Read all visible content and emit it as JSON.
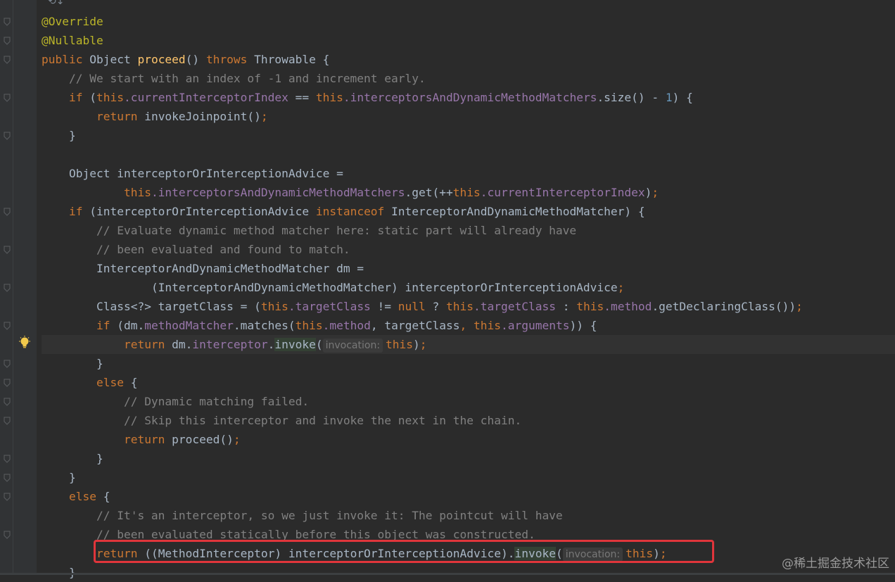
{
  "editor": {
    "top_icons": "⟲↓",
    "watermark": "@稀土掘金技术社区",
    "lines": {
      "l1": "@Override",
      "l2": "@Nullable",
      "l3_public": "public",
      "l3_object": " Object ",
      "l3_name": "proceed",
      "l3_paren": "() ",
      "l3_throws": "throws",
      "l3_rest": " Throwable {",
      "l4": "    // We start with an index of -1 and increment early.",
      "l5_if": "if",
      "l5_a": " (",
      "l5_this1": "this",
      "l5_f1": ".currentInterceptorIndex",
      "l5_b": " == ",
      "l5_this2": "this",
      "l5_f2": ".interceptorsAndDynamicMethodMatchers",
      "l5_c": ".size() - ",
      "l5_num": "1",
      "l5_d": ") {",
      "l6_return": "return",
      "l6_rest": " invokeJoinpoint()",
      "l6_semi": ";",
      "l7": "}",
      "l9": "Object interceptorOrInterceptionAdvice =",
      "l10_this1": "this",
      "l10_f1": ".interceptorsAndDynamicMethodMatchers",
      "l10_a": ".get(++",
      "l10_this2": "this",
      "l10_f2": ".currentInterceptorIndex",
      "l10_b": ")",
      "l10_semi": ";",
      "l11_if": "if",
      "l11_a": " (interceptorOrInterceptionAdvice ",
      "l11_instanceof": "instanceof",
      "l11_b": " InterceptorAndDynamicMethodMatcher) {",
      "l12": "// Evaluate dynamic method matcher here: static part will already have",
      "l13": "// been evaluated and found to match.",
      "l14": "InterceptorAndDynamicMethodMatcher dm =",
      "l15_a": "(InterceptorAndDynamicMethodMatcher) interceptorOrInterceptionAdvice",
      "l15_semi": ";",
      "l16_a": "Class<?> targetClass = (",
      "l16_this1": "this",
      "l16_f1": ".targetClass",
      "l16_b": " != ",
      "l16_null": "null",
      "l16_c": " ? ",
      "l16_this2": "this",
      "l16_f2": ".targetClass",
      "l16_d": " : ",
      "l16_this3": "this",
      "l16_f3": ".method",
      "l16_e": ".getDeclaringClass())",
      "l16_semi": ";",
      "l17_if": "if",
      "l17_a": " (dm.",
      "l17_f1": "methodMatcher",
      "l17_b": ".matches(",
      "l17_this1": "this",
      "l17_f2": ".method",
      "l17_c": ", targetClass",
      "l17_comma": ", ",
      "l17_this2": "this",
      "l17_f3": ".arguments",
      "l17_d": ")) {",
      "l18_return": "return",
      "l18_a": " dm.",
      "l18_f1": "interceptor",
      "l18_b": ".",
      "l18_invoke": "invoke",
      "l18_c": "(",
      "l18_hint": "invocation:",
      "l18_this": "this",
      "l18_d": ")",
      "l18_semi": ";",
      "l19": "}",
      "l20_else": "else",
      "l20_a": " {",
      "l21": "// Dynamic matching failed.",
      "l22": "// Skip this interceptor and invoke the next in the chain.",
      "l23_return": "return",
      "l23_a": " proceed()",
      "l23_semi": ";",
      "l24": "}",
      "l25": "}",
      "l26_else": "else",
      "l26_a": " {",
      "l27": "// It's an interceptor, so we just invoke it: The pointcut will have",
      "l28": "// been evaluated statically before this object was constructed.",
      "l29_return": "return",
      "l29_a": " ((MethodInterceptor) interceptorOrInterceptionAdvice).",
      "l29_invoke": "invoke",
      "l29_b": "(",
      "l29_hint": "invocation:",
      "l29_this": "this",
      "l29_c": ")",
      "l29_semi": ";",
      "l30": "}"
    }
  },
  "colors": {
    "background": "#2b2b2b",
    "keyword": "#cc7832",
    "annotation": "#bbb529",
    "method_decl": "#ffc66d",
    "field": "#9876aa",
    "number": "#6897bb",
    "comment": "#808080",
    "highlight_border": "#e0353b"
  },
  "icons": {
    "gutter_fold": "fold-marker-icon",
    "intention": "lightbulb-icon"
  }
}
